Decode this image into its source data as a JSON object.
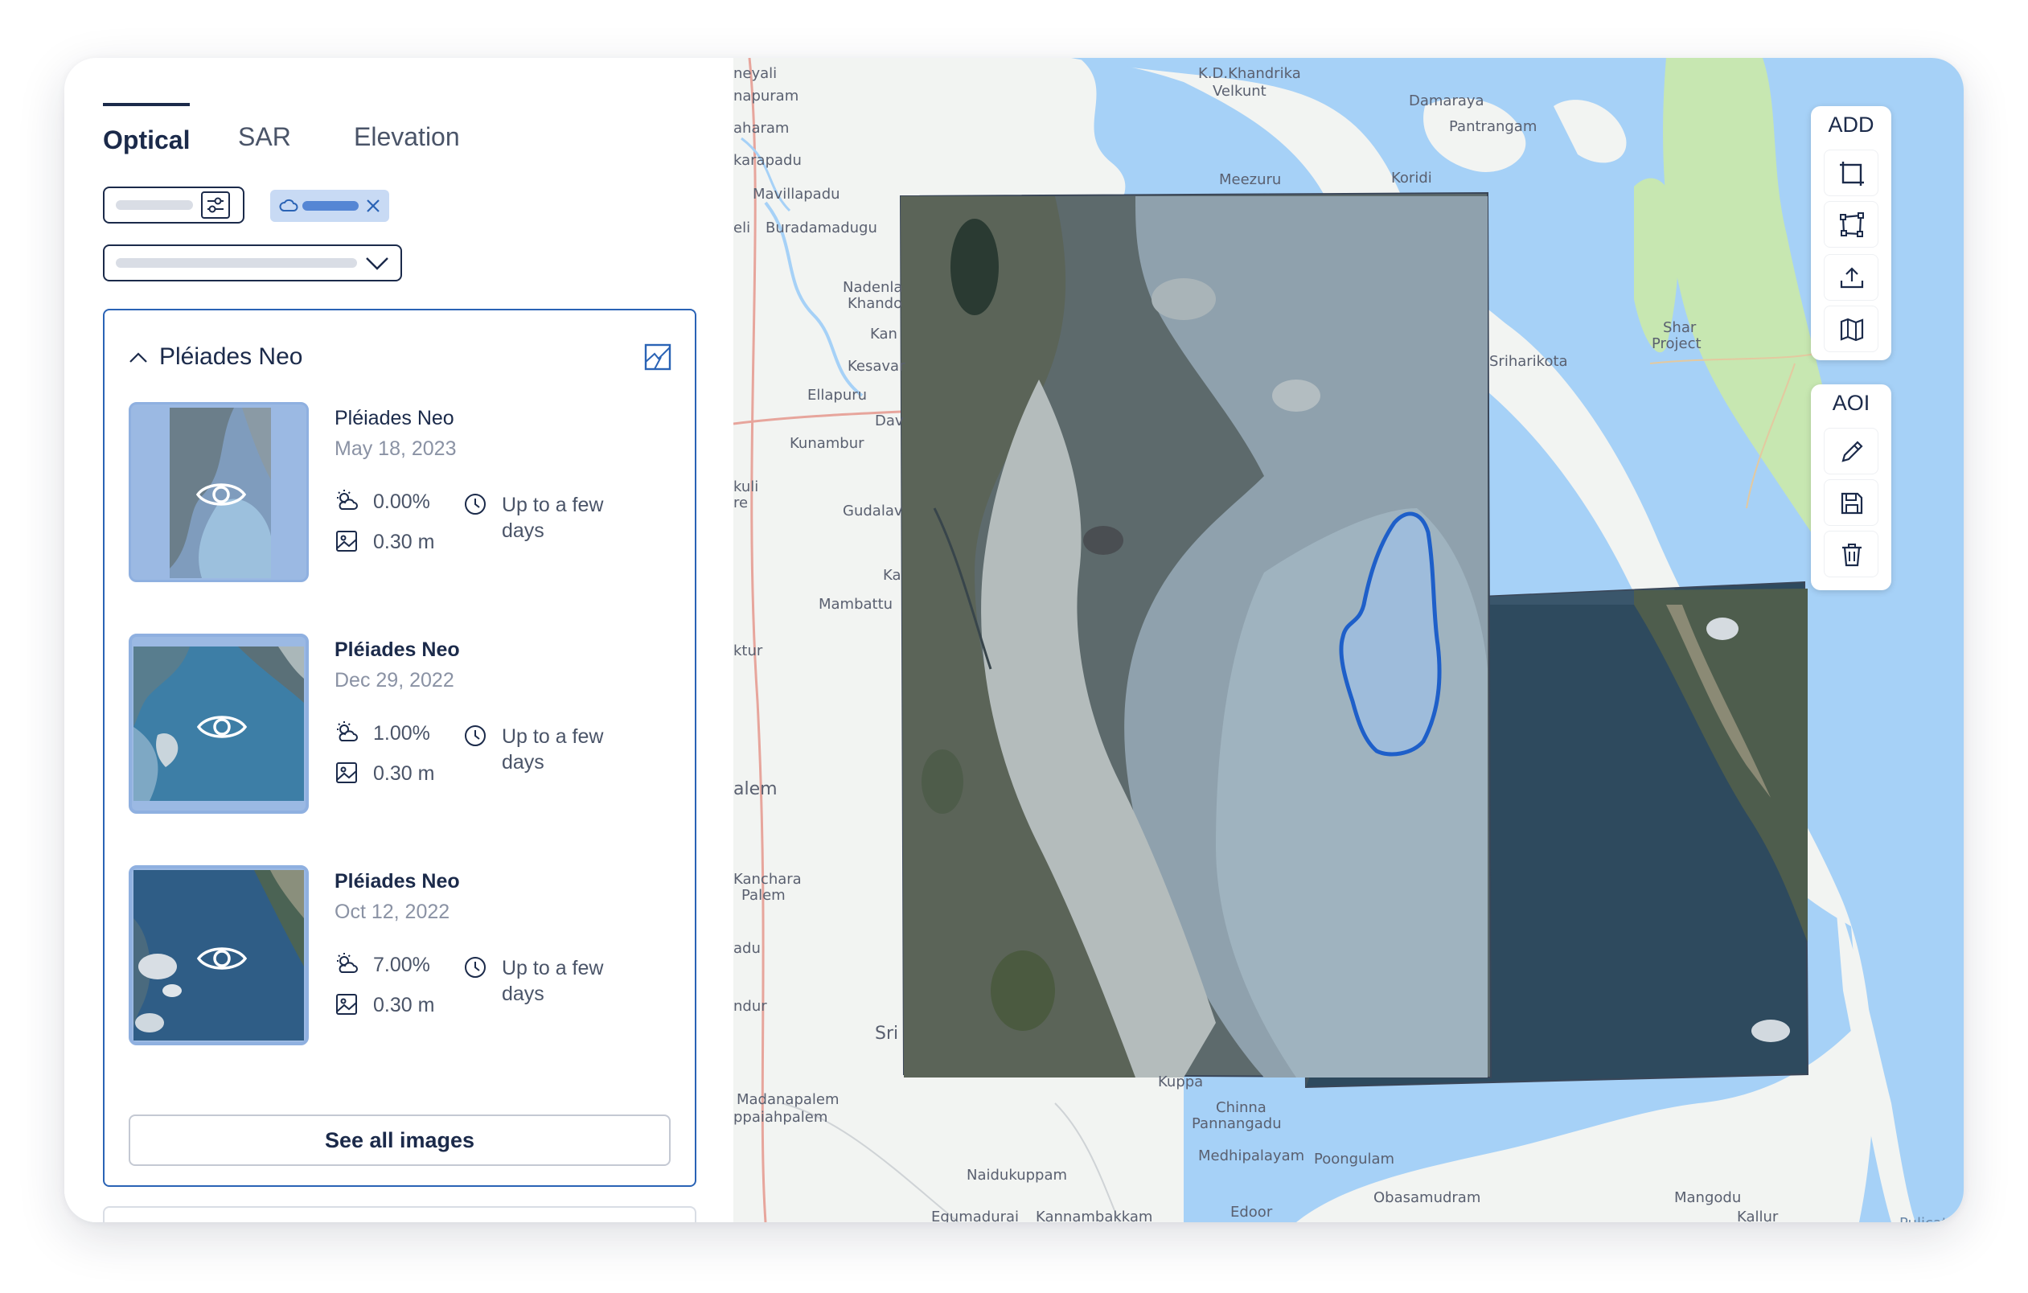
{
  "tabs": [
    {
      "label": "Optical",
      "active": true
    },
    {
      "label": "SAR",
      "active": false
    },
    {
      "label": "Elevation",
      "active": false
    }
  ],
  "filters": {
    "cloud_chip_icon": "cloud-icon",
    "remove_icon": "close-icon",
    "settings_icon": "sliders-icon",
    "dropdown_icon": "chevron-down-icon"
  },
  "group": {
    "title": "Pléiades Neo",
    "collapse_icon": "chevron-up-icon",
    "footprint_icon": "footprint-icon",
    "items": [
      {
        "title": "Pléiades Neo",
        "date": "May 18, 2023",
        "cloud": "0.00%",
        "delivery": "Up to a few days",
        "resolution": "0.30 m",
        "selected": false
      },
      {
        "title": "Pléiades Neo",
        "date": "Dec 29, 2022",
        "cloud": "1.00%",
        "delivery": "Up to a few days",
        "resolution": "0.30 m",
        "selected": true
      },
      {
        "title": "Pléiades Neo",
        "date": "Oct 12, 2022",
        "cloud": "7.00%",
        "delivery": "Up to a few days",
        "resolution": "0.30 m",
        "selected": true
      }
    ],
    "see_all_label": "See all images"
  },
  "map": {
    "place_labels": {
      "nayapuram": "napuram",
      "nevali": "neyali",
      "aharam": "aharam",
      "karapadu": "karapadu",
      "mavillapadu": "Mavillapadu",
      "eli": "eli",
      "buradamadugu": "Buradamadugu",
      "nadenla": "Nadenla",
      "khando": "Khando",
      "kan": "Kan",
      "kesava": "Kesavar",
      "ellapuru": "Ellapuru",
      "davi": "Dav",
      "kunambur": "Kunambur",
      "kuli": "kuli",
      "re": "re",
      "gudala": "Gudalav",
      "ka": "Ka",
      "mambattu": "Mambattu",
      "ktur": "ktur",
      "alem": "alem",
      "kanchara": "Kanchara",
      "palem": "Palem",
      "padu": "adu",
      "ndur": "ndur",
      "sri": "Sri",
      "madanapalem": "Madanapalem",
      "ppaiahpalem": "ppaiahpalem",
      "naidukuppam": "Naidukuppam",
      "egumadurai": "Egumadurai",
      "kannambakkam": "Kannambakkam",
      "kuppa": "Kuppa",
      "chinna": "Chinna",
      "pannangadu": "Pannangadu",
      "medhipalayam": "Medhipalayam",
      "poongulam": "Poongulam",
      "edoor": "Edoor",
      "obasamudram": "Obasamudram",
      "mangodu": "Mangodu",
      "kallur": "Kallur",
      "pulicat": "Pulicat",
      "kd_khandrika": "K.D.Khandrika",
      "velkunt": "Velkunt",
      "damaraya": "Damaraya",
      "pantrangam": "Pantrangam",
      "meezuru": "Meezuru",
      "koridi": "Koridi",
      "sriharikota": "Sriharikota",
      "shar": "Shar",
      "project": "Project"
    },
    "colors": {
      "water": "#a6d1f7",
      "land": "#f2f4f2",
      "vegetation": "#c7e7b1",
      "road": "#e7a59c",
      "aoi_stroke": "#1e5fc9",
      "accent": "#2a63b5"
    }
  },
  "toolbar": {
    "add_label": "ADD",
    "add_buttons": [
      "rectangle-icon",
      "polygon-icon",
      "upload-icon",
      "map-book-icon"
    ],
    "aoi_label": "AOI",
    "aoi_buttons": [
      "pencil-icon",
      "save-icon",
      "trash-icon"
    ]
  }
}
